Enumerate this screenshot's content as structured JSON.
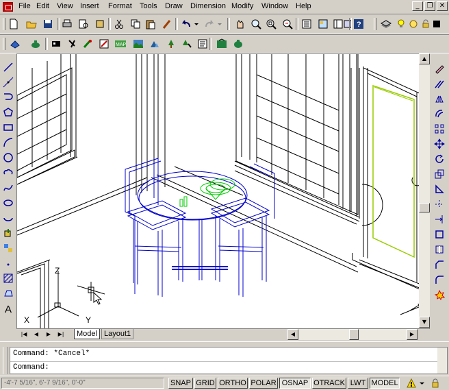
{
  "menu": [
    "File",
    "Edit",
    "View",
    "Insert",
    "Format",
    "Tools",
    "Draw",
    "Dimension",
    "Modify",
    "Window",
    "Help"
  ],
  "window_buttons": [
    "_",
    "❐",
    "✕"
  ],
  "tabs": {
    "model": "Model",
    "layout": "Layout1"
  },
  "ucs": {
    "z": "Z",
    "y": "Y",
    "x": "X"
  },
  "command": {
    "history": "Command: *Cancel*",
    "prompt": "Command:"
  },
  "status": {
    "coords": "-4'-7 5/16\", 6'-7 9/16\", 0'-0\"",
    "toggles": [
      {
        "label": "SNAP",
        "on": false
      },
      {
        "label": "GRID",
        "on": false
      },
      {
        "label": "ORTHO",
        "on": false
      },
      {
        "label": "POLAR",
        "on": false
      },
      {
        "label": "OSNAP",
        "on": true
      },
      {
        "label": "OTRACK",
        "on": false
      },
      {
        "label": "LWT",
        "on": false
      },
      {
        "label": "MODEL",
        "on": true
      }
    ]
  },
  "colors": {
    "wire": "#000000",
    "furniture": "#0000cc",
    "accent": "#00cc00",
    "door": "#99cc00"
  }
}
